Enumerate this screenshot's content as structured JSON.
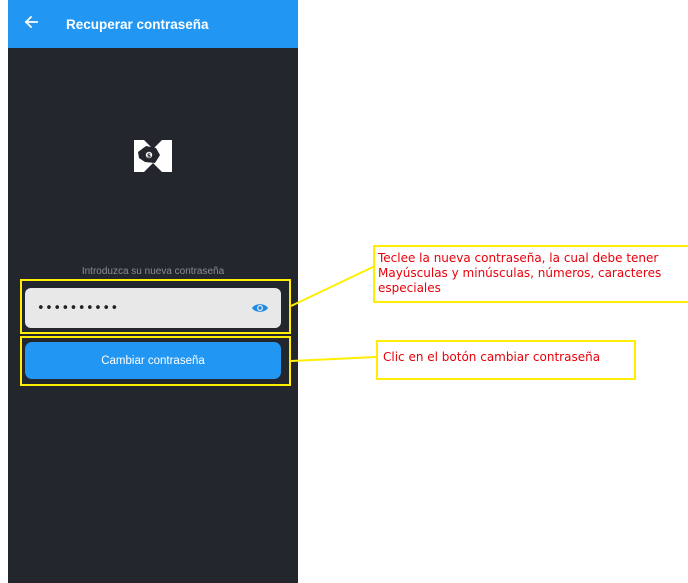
{
  "appbar": {
    "back_icon": "arrow-left-icon",
    "title": "Recuperar contraseña"
  },
  "logo": {
    "icon": "hand-money-logo"
  },
  "form": {
    "hint": "Introduzca su nueva contraseña",
    "password_value": "••••••••••",
    "toggle_icon": "eye-icon",
    "submit_label": "Cambiar contraseña"
  },
  "annotations": {
    "password_note": {
      "line1": "Teclee la nueva contraseña, la cual debe tener",
      "line2": "Mayúsculas y  minúsculas, números, caracteres",
      "line3": "especiales"
    },
    "button_note": "Clic en el botón cambiar contraseña"
  },
  "colors": {
    "appbar": "#2196f3",
    "screen_bg": "#23262c",
    "button": "#2196f3",
    "highlight": "#ffee00",
    "annotation_text": "#e8000b"
  }
}
